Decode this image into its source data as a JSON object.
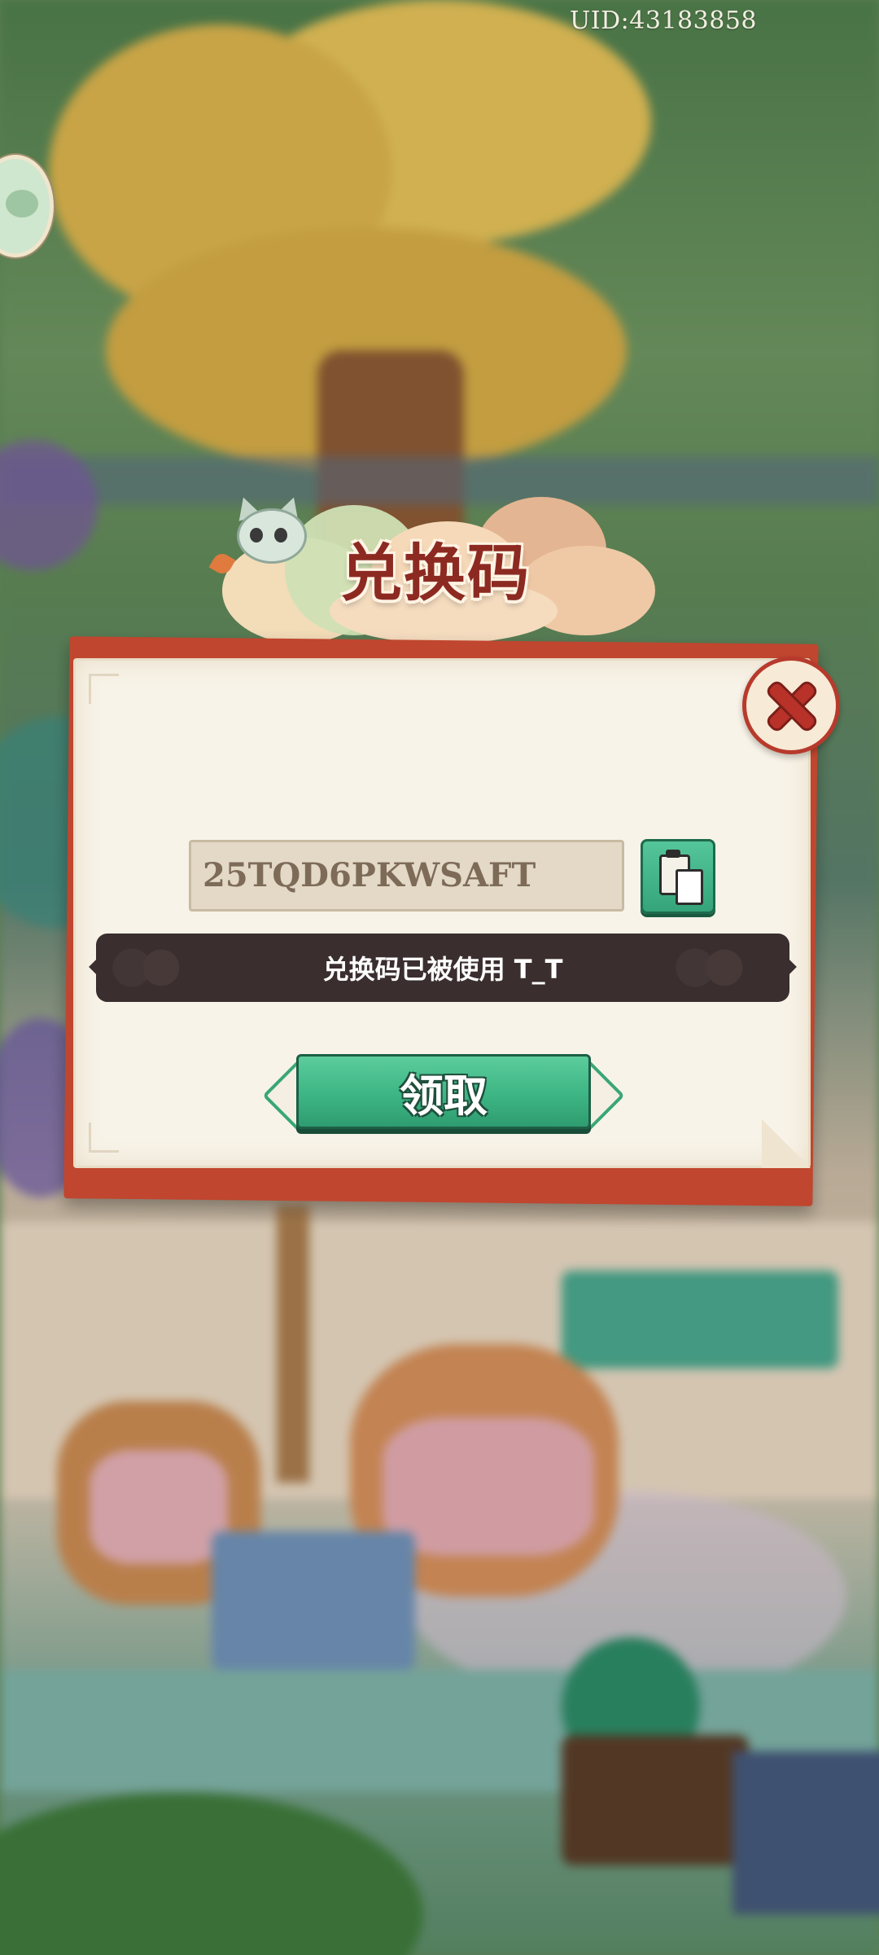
{
  "header": {
    "uid_text": "UID:43183858"
  },
  "dialog": {
    "title": "兑换码",
    "code_value": "25TQD6PKWSAFT",
    "toast_message": "兑换码已被使用 T_T",
    "claim_label": "领取"
  },
  "icons": {
    "close": "close-icon",
    "paste": "paste-icon",
    "mascot": "cat-mascot-icon",
    "side_avatar": "avatar-icon"
  },
  "colors": {
    "title_text": "#8c2a22",
    "frame_red": "#c0462f",
    "button_green": "#3db584",
    "toast_bg": "#3a2e2e"
  }
}
